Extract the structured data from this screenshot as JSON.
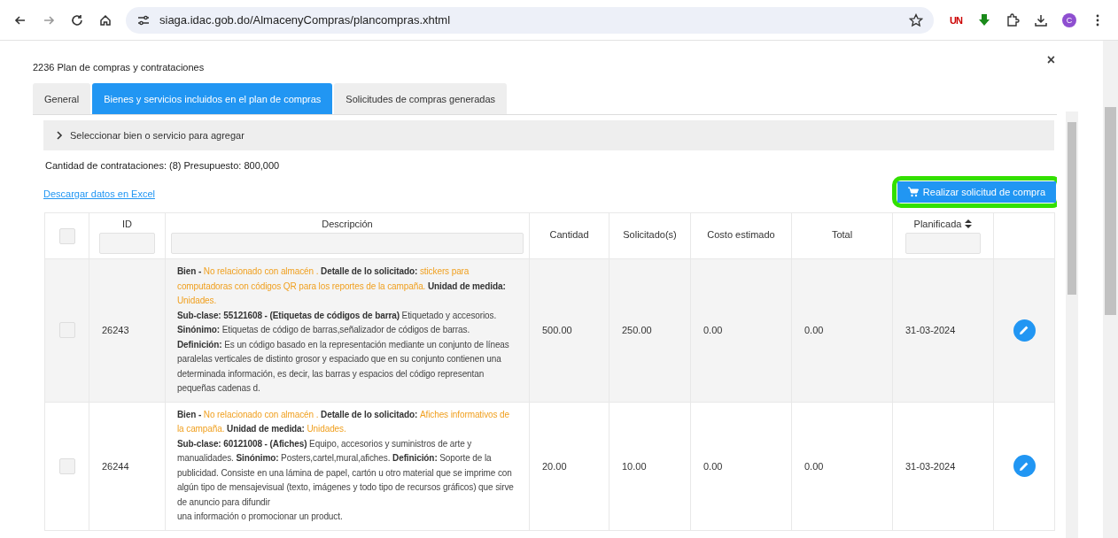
{
  "browser": {
    "url": "siaga.idac.gob.do/AlmacenyCompras/plancompras.xhtml",
    "extension_badge": "UN",
    "profile_initial": "C"
  },
  "dialog": {
    "title": "2236 Plan de compras y contrataciones",
    "close": "×"
  },
  "tabs": [
    {
      "label": "General",
      "selected": false
    },
    {
      "label": "Bienes y servicios incluidos en el plan de compras",
      "selected": true
    },
    {
      "label": "Solicitudes de compras generadas",
      "selected": false
    }
  ],
  "add_panel": {
    "label": "Seleccionar bien o servicio para agregar",
    "expanded": false
  },
  "summary": "Cantidad de contrataciones: (8) Presupuesto: 800,000",
  "excel_link": "Descargar datos en Excel",
  "purchase_button": {
    "label": "Realizar solicitud de compra",
    "highlighted": true
  },
  "table": {
    "select_all": {
      "checked": false
    },
    "columns": [
      {
        "kind": "checkbox"
      },
      {
        "label": "ID",
        "kind": "text",
        "filter": true
      },
      {
        "label": "Descripción",
        "kind": "text",
        "filter": true
      },
      {
        "label": "Cantidad",
        "kind": "text",
        "filter": false
      },
      {
        "label": "Solicitado(s)",
        "kind": "text",
        "filter": false
      },
      {
        "label": "Costo estimado",
        "kind": "text",
        "filter": false
      },
      {
        "label": "Total",
        "kind": "text",
        "filter": false
      },
      {
        "label": "Planificada",
        "kind": "sortable",
        "filter": true
      },
      {
        "kind": "action"
      }
    ],
    "rows": [
      {
        "checked": false,
        "id": "26243",
        "description": [
          [
            {
              "kind": "label",
              "text": "Bien - "
            },
            {
              "kind": "value",
              "text": "No relacionado con almacén . "
            },
            {
              "kind": "label",
              "text": "Detalle de lo solicitado: "
            },
            {
              "kind": "value",
              "text": "stickers para computadoras con códigos QR para los reportes de la campaña. "
            },
            {
              "kind": "label",
              "text": "Unidad de medida: "
            },
            {
              "kind": "value",
              "text": "Unidades."
            }
          ],
          [
            {
              "kind": "label",
              "text": "Sub-clase: 55121608 - (Etiquetas de códigos de barra) "
            },
            {
              "kind": "text",
              "text": "Etiquetado y accesorios."
            }
          ],
          [
            {
              "kind": "label",
              "text": "Sinónimo: "
            },
            {
              "kind": "text",
              "text": "Etiquetas de código de barras,señalizador de códigos de barras."
            }
          ],
          [
            {
              "kind": "label",
              "text": "Definición: "
            },
            {
              "kind": "text",
              "text": "Es un código basado en la representación mediante un conjunto de líneas paralelas verticales de distinto grosor y espaciado que en su conjunto contienen una determinada información, es decir, las barras y espacios del código representan pequeñas cadenas d."
            }
          ]
        ],
        "cantidad": "500.00",
        "solicitado": "250.00",
        "costo": "0.00",
        "total": "0.00",
        "planificada": "31-03-2024"
      },
      {
        "checked": false,
        "id": "26244",
        "description": [
          [
            {
              "kind": "label",
              "text": "Bien - "
            },
            {
              "kind": "value",
              "text": "No relacionado con almacén . "
            },
            {
              "kind": "label",
              "text": "Detalle de lo solicitado: "
            },
            {
              "kind": "value",
              "text": "Afiches informativos de la campaña. "
            },
            {
              "kind": "label",
              "text": "Unidad de medida: "
            },
            {
              "kind": "value",
              "text": "Unidades."
            }
          ],
          [
            {
              "kind": "label",
              "text": "Sub-clase: 60121008 - (Afiches) "
            },
            {
              "kind": "text",
              "text": "Equipo, accesorios y suministros de arte y manualidades. "
            },
            {
              "kind": "label",
              "text": "Sinónimo: "
            },
            {
              "kind": "text",
              "text": "Posters,cartel,mural,afiches. "
            },
            {
              "kind": "label",
              "text": "Definición: "
            },
            {
              "kind": "text",
              "text": "Soporte de la publicidad. Consiste en una lámina de papel, cartón u otro material que se imprime con algún tipo de mensajevisual (texto, imágenes y todo tipo de recursos gráficos) que sirve de anuncio para difundir"
            }
          ],
          [
            {
              "kind": "text",
              "text": "una información o promocionar un product."
            }
          ]
        ],
        "cantidad": "20.00",
        "solicitado": "10.00",
        "costo": "0.00",
        "total": "0.00",
        "planificada": "31-03-2024"
      }
    ]
  }
}
